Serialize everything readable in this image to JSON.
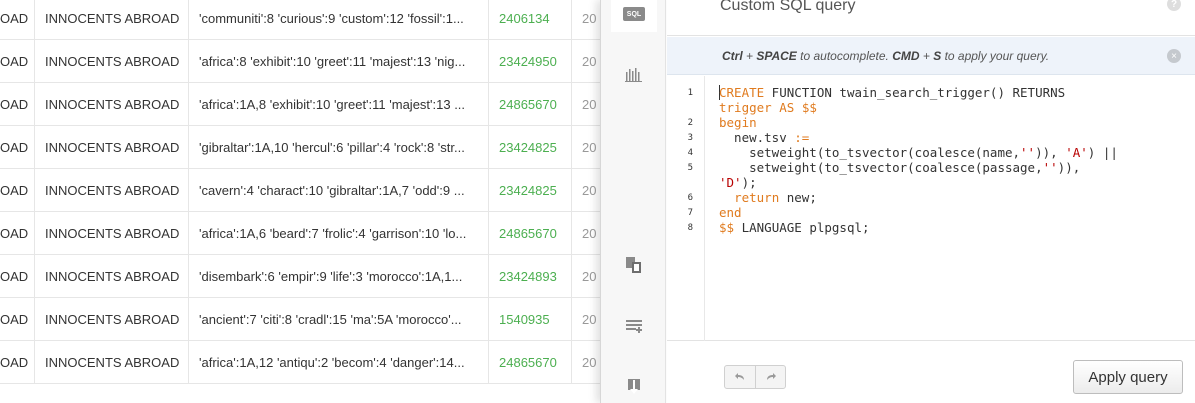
{
  "table": {
    "rows": [
      {
        "partial": "OAD",
        "title": "INNOCENTS ABROAD",
        "tsv": "'communiti':8 'curious':9 'custom':12 'fossil':1...",
        "id": "2406134",
        "partial2": "20"
      },
      {
        "partial": "OAD",
        "title": "INNOCENTS ABROAD",
        "tsv": "'africa':8 'exhibit':10 'greet':11 'majest':13 'nig...",
        "id": "23424950",
        "partial2": "20"
      },
      {
        "partial": "OAD",
        "title": "INNOCENTS ABROAD",
        "tsv": "'africa':1A,8 'exhibit':10 'greet':11 'majest':13 ...",
        "id": "24865670",
        "partial2": "20"
      },
      {
        "partial": "OAD",
        "title": "INNOCENTS ABROAD",
        "tsv": "'gibraltar':1A,10 'hercul':6 'pillar':4 'rock':8 'str...",
        "id": "23424825",
        "partial2": "20"
      },
      {
        "partial": "OAD",
        "title": "INNOCENTS ABROAD",
        "tsv": "'cavern':4 'charact':10 'gibraltar':1A,7 'odd':9 ...",
        "id": "23424825",
        "partial2": "20"
      },
      {
        "partial": "OAD",
        "title": "INNOCENTS ABROAD",
        "tsv": "'africa':1A,6 'beard':7 'frolic':4 'garrison':10 'lo...",
        "id": "24865670",
        "partial2": "20"
      },
      {
        "partial": "OAD",
        "title": "INNOCENTS ABROAD",
        "tsv": "'disembark':6 'empir':9 'life':3 'morocco':1A,1...",
        "id": "23424893",
        "partial2": "20"
      },
      {
        "partial": "OAD",
        "title": "INNOCENTS ABROAD",
        "tsv": "'ancient':7 'citi':8 'cradl':15 'ma':5A 'morocco'...",
        "id": "1540935",
        "partial2": "20"
      },
      {
        "partial": "OAD",
        "title": "INNOCENTS ABROAD",
        "tsv": "'africa':1A,12 'antiqu':2 'becom':4 'danger':14...",
        "id": "24865670",
        "partial2": "20"
      }
    ]
  },
  "sidebar": {
    "sql_badge": "SQL",
    "icons": [
      "sql-icon",
      "bar-chart-icon",
      "merge-icon",
      "filter-icon",
      "export-icon"
    ]
  },
  "panel": {
    "title": "Custom SQL query",
    "help": "?",
    "hint": {
      "key1": "Ctrl",
      "plus1": " + ",
      "key2": "SPACE",
      "text1": " to autocomplete. ",
      "key3": "CMD",
      "plus2": " + ",
      "key4": "S",
      "text2": " to apply your query."
    },
    "close": "×",
    "line_numbers": [
      "1",
      "2",
      "3",
      "4",
      "5",
      "6",
      "7",
      "8"
    ],
    "code": {
      "l1a": "CREATE",
      "l1b": " FUNCTION twain_search_trigger() RETURNS",
      "l1c": "trigger",
      "l1d": " ",
      "l1e": "AS",
      "l1f": " ",
      "l1g": "$$",
      "l2": "begin",
      "l3a": "  new.tsv ",
      "l3b": ":=",
      "l4a": "    setweight(to_tsvector(coalesce(name,",
      "l4b": "''",
      "l4c": ")), ",
      "l4d": "'A'",
      "l4e": ") ||",
      "l5a": "    setweight(to_tsvector(coalesce(passage,",
      "l5b": "''",
      "l5c": ")),",
      "l5d": "'D'",
      "l5e": ");",
      "l6a": "  ",
      "l6b": "return",
      "l6c": " new;",
      "l7": "end",
      "l8a": "$$",
      "l8b": " LANGUAGE plpgsql;"
    },
    "apply_label": "Apply query",
    "undo_icon": "undo-icon",
    "redo_icon": "redo-icon"
  },
  "colors": {
    "keyword": "#e07b1f",
    "string": "#b80000",
    "id_green": "#4caf50",
    "hint_bg": "#eef3fa"
  }
}
